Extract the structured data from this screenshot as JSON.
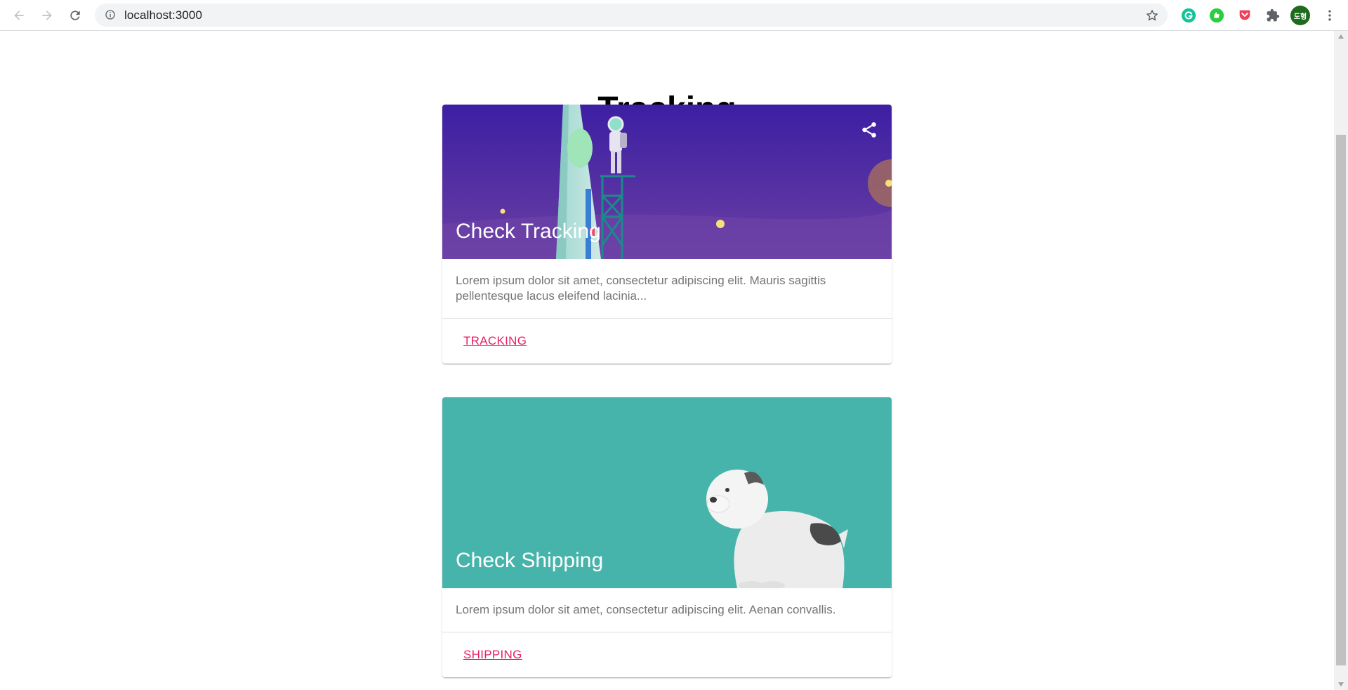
{
  "browser": {
    "url": "localhost:3000",
    "avatar_text": "도형",
    "icons": {
      "back": "arrow-left-icon",
      "forward": "arrow-right-icon",
      "reload": "reload-icon",
      "site_info": "info-icon",
      "bookmark": "star-icon",
      "extensions": [
        "grammarly-icon",
        "green-extension-icon",
        "pocket-icon",
        "puzzle-icon"
      ],
      "menu": "more-vertical-icon"
    }
  },
  "page": {
    "heading": "Tracking",
    "cards": [
      {
        "title": "Check Tracking",
        "description": "Lorem ipsum dolor sit amet, consectetur adipiscing elit. Mauris sagittis pellentesque lacus eleifend lacinia...",
        "link": "TRACKING",
        "share_icon": "share-icon",
        "media_color": "#4a2a9e"
      },
      {
        "title": "Check Shipping",
        "description": "Lorem ipsum dolor sit amet, consectetur adipiscing elit. Aenan convallis.",
        "link": "SHIPPING",
        "media_color": "#47b4ab"
      }
    ]
  },
  "colors": {
    "accent": "#e91e63",
    "text_muted": "#757575"
  }
}
